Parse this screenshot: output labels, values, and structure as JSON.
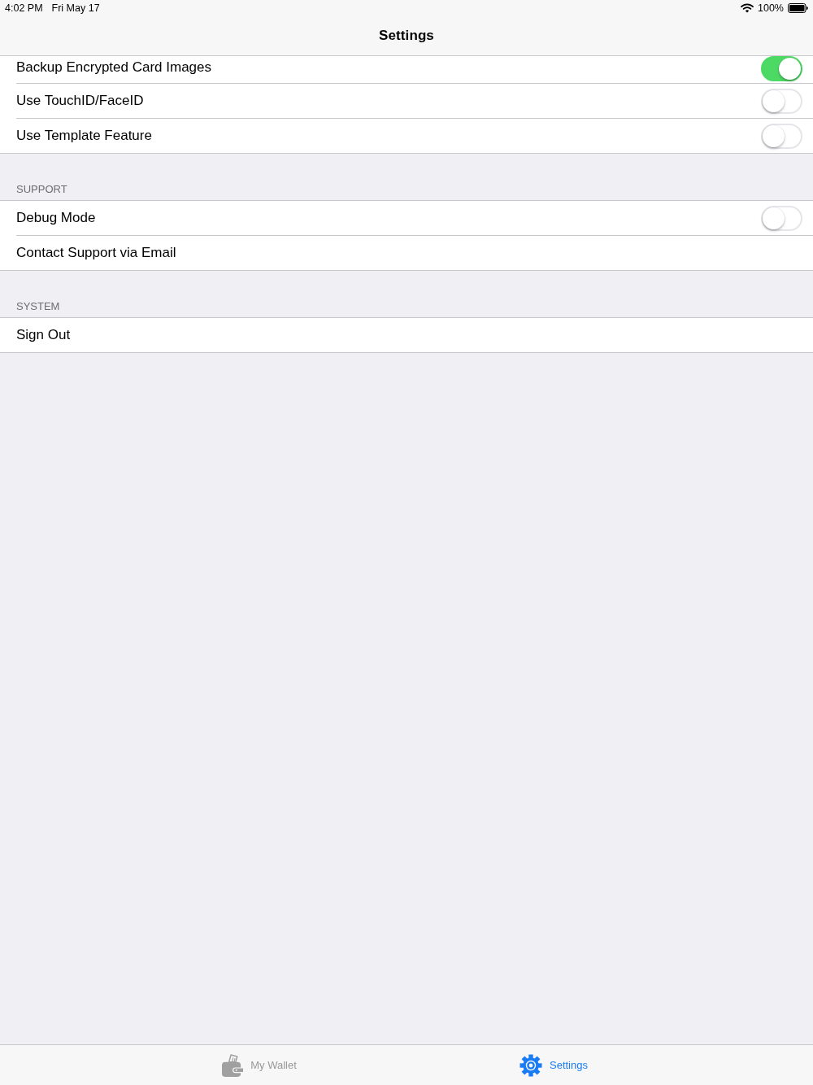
{
  "status_bar": {
    "time": "4:02 PM",
    "date": "Fri May 17",
    "battery": "100%"
  },
  "nav_bar": {
    "title": "Settings"
  },
  "sections": [
    {
      "rows": [
        {
          "label": "Backup Encrypted Card Images",
          "kind": "toggle",
          "on": true
        },
        {
          "label": "Use TouchID/FaceID",
          "kind": "toggle",
          "on": false
        },
        {
          "label": "Use Template Feature",
          "kind": "toggle",
          "on": false
        }
      ]
    },
    {
      "header": "SUPPORT",
      "rows": [
        {
          "label": "Debug Mode",
          "kind": "toggle",
          "on": false
        },
        {
          "label": "Contact Support via Email",
          "kind": "action"
        }
      ]
    },
    {
      "header": "SYSTEM",
      "rows": [
        {
          "label": "Sign Out",
          "kind": "action"
        }
      ]
    }
  ],
  "tab_bar": {
    "items": [
      {
        "label": "My Wallet",
        "kind": "wallet",
        "selected": false
      },
      {
        "label": "Settings",
        "kind": "settings",
        "selected": true
      }
    ]
  }
}
